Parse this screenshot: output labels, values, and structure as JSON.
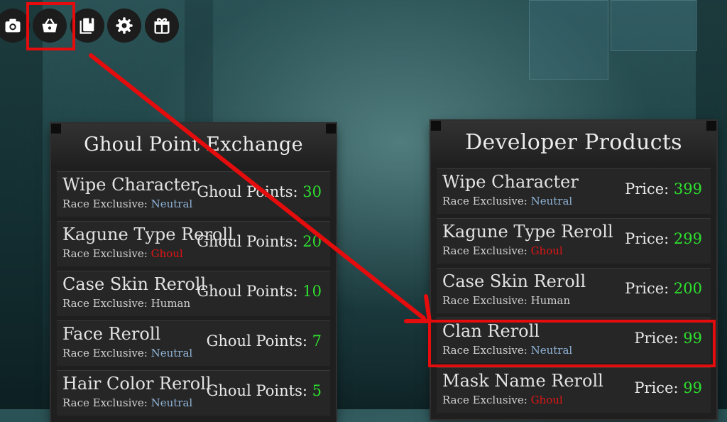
{
  "colors": {
    "highlight": "#e40c0c",
    "neutral": "#8fb3d6",
    "ghoul": "#e01515",
    "human": "#cfcfcf",
    "value": "#2ee02e"
  },
  "toolbar": {
    "buttons": [
      {
        "icon": "camera-icon"
      },
      {
        "icon": "shop-basket-icon"
      },
      {
        "icon": "book-icon"
      },
      {
        "icon": "gear-icon"
      },
      {
        "icon": "gift-icon"
      }
    ]
  },
  "ghoul_exchange": {
    "title": "Ghoul Point Exchange",
    "cost_label": "Ghoul Points:",
    "race_prefix": "Race Exclusive:",
    "items": [
      {
        "name": "Wipe Character",
        "race": "Neutral",
        "cost": "30"
      },
      {
        "name": "Kagune Type Reroll",
        "race": "Ghoul",
        "cost": "20"
      },
      {
        "name": "Case Skin Reroll",
        "race": "Human",
        "cost": "10"
      },
      {
        "name": "Face Reroll",
        "race": "Neutral",
        "cost": "7"
      },
      {
        "name": "Hair Color Reroll",
        "race": "Neutral",
        "cost": "5"
      }
    ]
  },
  "developer_products": {
    "title": "Developer Products",
    "cost_label": "Price:",
    "race_prefix": "Race Exclusive:",
    "items": [
      {
        "name": "Wipe Character",
        "race": "Neutral",
        "cost": "399"
      },
      {
        "name": "Kagune Type Reroll",
        "race": "Ghoul",
        "cost": "299"
      },
      {
        "name": "Case Skin Reroll",
        "race": "Human",
        "cost": "200"
      },
      {
        "name": "Clan Reroll",
        "race": "Neutral",
        "cost": "99"
      },
      {
        "name": "Mask Name Reroll",
        "race": "Ghoul",
        "cost": "99"
      }
    ]
  }
}
